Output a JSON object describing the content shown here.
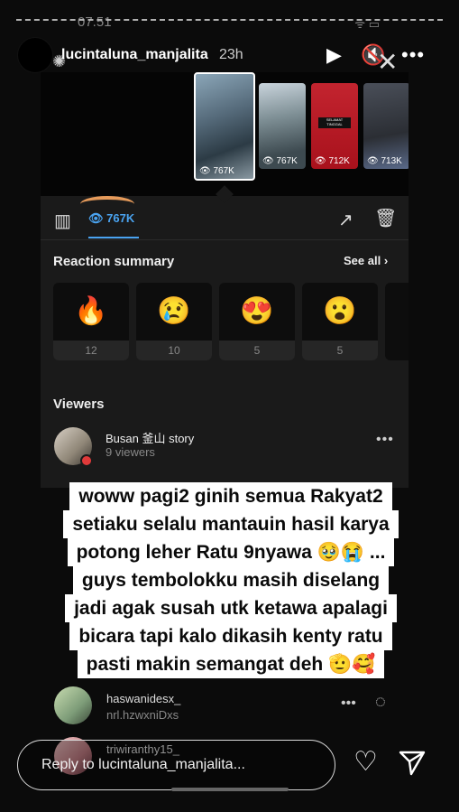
{
  "status": {
    "time": "07.51",
    "icons": "ᯤ ▭"
  },
  "header": {
    "username": "lucintaluna_manjalita",
    "age": "23h",
    "play_icon": "▶",
    "mute_icon": "🔇",
    "more_icon": "•••",
    "close_icon": "✕"
  },
  "screenshot": {
    "thumbnails": [
      {
        "views": "767K"
      },
      {
        "views": "767K"
      },
      {
        "views": "712K"
      },
      {
        "views": "713K"
      }
    ],
    "thumb3_banner": "SELAMAT TINGGAL",
    "view_count": "767K",
    "reaction_summary_title": "Reaction summary",
    "see_all": "See all",
    "reactions": [
      {
        "emoji": "🔥",
        "count": "12"
      },
      {
        "emoji": "😢",
        "count": "10"
      },
      {
        "emoji": "😍",
        "count": "5"
      },
      {
        "emoji": "😮",
        "count": "5"
      }
    ],
    "viewers_title": "Viewers",
    "viewers": [
      {
        "name": "Busan 釜山 story",
        "sub": "9 viewers"
      }
    ]
  },
  "caption": {
    "lines": [
      "woww pagi2 ginih semua Rakyat2",
      "setiaku selalu mantauin hasil karya",
      "potong leher Ratu 9nyawa 🥹😭 ...",
      "guys tembolokku masih diselang",
      "jadi agak susah utk ketawa apalagi",
      "bicara tapi kalo dikasih kenty ratu",
      "pasti makin semangat deh 🫡🥰"
    ]
  },
  "lower_viewers": [
    {
      "name": "haswanidesx_",
      "sub": "nrl.hzwxniDxs"
    },
    {
      "name": "triwiranthy15_",
      "sub": ""
    }
  ],
  "reply": {
    "placeholder": "Reply to lucintaluna_manjalita..."
  },
  "colors": {
    "accent": "#4aa3f0",
    "caption_bg": "#ffffff",
    "arc": "#e59a5a"
  }
}
